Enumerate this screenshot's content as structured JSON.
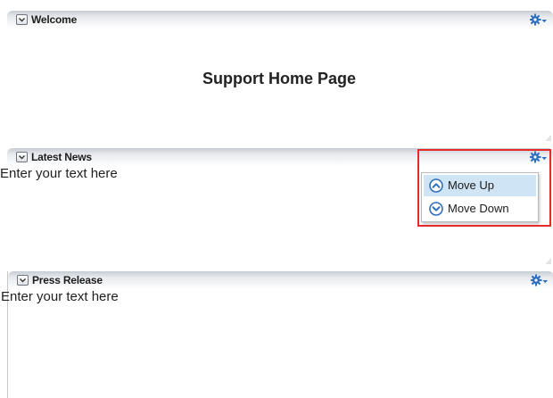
{
  "panels": {
    "welcome": {
      "title": "Welcome",
      "heading": "Support Home Page"
    },
    "latest_news": {
      "title": "Latest News",
      "body": "Enter your text here"
    },
    "press_release": {
      "title": "Press Release",
      "body": "Enter your text here"
    }
  },
  "panel_menu": {
    "items": [
      {
        "label": "Move Up",
        "icon": "arrow-up-circle-icon"
      },
      {
        "label": "Move Down",
        "icon": "arrow-down-circle-icon"
      }
    ]
  },
  "colors": {
    "accent_blue": "#2f6fbf",
    "menu_hover": "#cfe4f5",
    "highlight_red": "#e52a2a"
  }
}
